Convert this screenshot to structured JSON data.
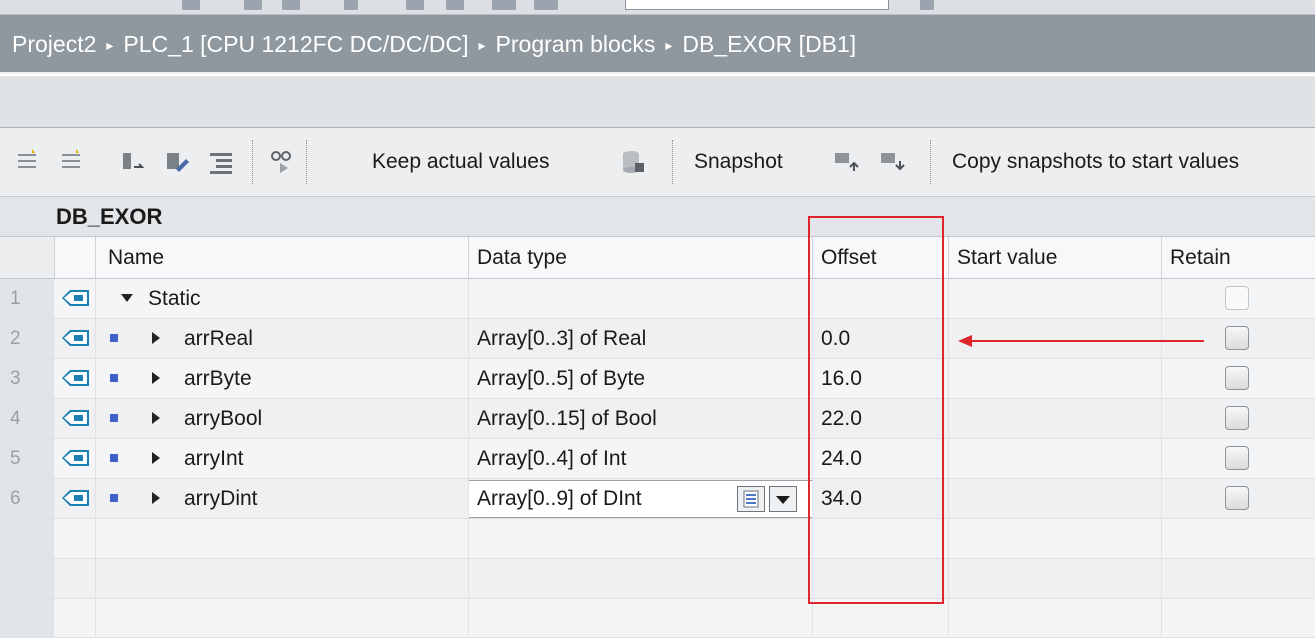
{
  "breadcrumb": {
    "items": [
      "Project2",
      "PLC_1 [CPU 1212FC DC/DC/DC]",
      "Program blocks",
      "DB_EXOR [DB1]"
    ],
    "separator": "▸"
  },
  "toolbar": {
    "keep_actual_values": "Keep actual values",
    "snapshot": "Snapshot",
    "copy_snapshots": "Copy snapshots to start values"
  },
  "block_title": "DB_EXOR",
  "table": {
    "columns": [
      "Name",
      "Data type",
      "Offset",
      "Start value",
      "Retain"
    ],
    "rows": [
      {
        "num": "1",
        "name": "Static",
        "data_type": "",
        "offset": "",
        "start_value": "",
        "retain": false,
        "expanded": true,
        "level": 0
      },
      {
        "num": "2",
        "name": "arrReal",
        "data_type": "Array[0..3] of Real",
        "offset": "0.0",
        "start_value": "",
        "retain": false,
        "expanded": false,
        "level": 1
      },
      {
        "num": "3",
        "name": "arrByte",
        "data_type": "Array[0..5] of Byte",
        "offset": "16.0",
        "start_value": "",
        "retain": false,
        "expanded": false,
        "level": 1
      },
      {
        "num": "4",
        "name": "arryBool",
        "data_type": "Array[0..15] of Bool",
        "offset": "22.0",
        "start_value": "",
        "retain": false,
        "expanded": false,
        "level": 1
      },
      {
        "num": "5",
        "name": "arryInt",
        "data_type": "Array[0..4] of Int",
        "offset": "24.0",
        "start_value": "",
        "retain": false,
        "expanded": false,
        "level": 1
      },
      {
        "num": "6",
        "name": "arryDint",
        "data_type": "Array[0..9] of DInt",
        "offset": "34.0",
        "start_value": "",
        "retain": false,
        "expanded": false,
        "level": 1
      }
    ]
  },
  "colors": {
    "breadcrumb_bg": "#8f989f",
    "highlight": "#e0262d",
    "member_marker": "#3c62c7"
  }
}
